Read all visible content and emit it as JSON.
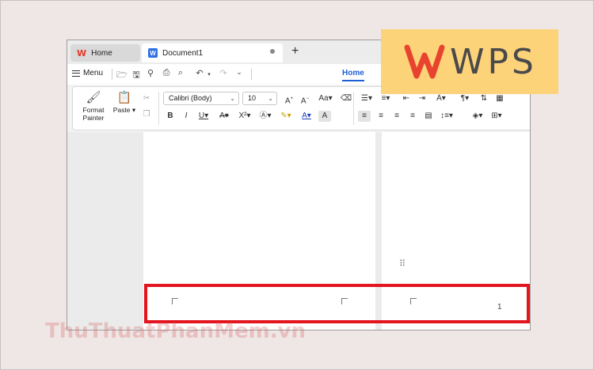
{
  "tabs": {
    "home_label": "Home",
    "document_label": "Document1",
    "new_tab_symbol": "+"
  },
  "menu": {
    "menu_label": "Menu",
    "active_ribbon_tab": "Home"
  },
  "ribbon": {
    "format_painter_label": "Format\nPainter",
    "paste_label": "Paste",
    "font_name": "Calibri (Body)",
    "font_size": "10"
  },
  "document": {
    "page_number": "1"
  },
  "brand": {
    "logo_text": "WPS",
    "accent_color": "#e3151e",
    "logo_bg": "#fdd37a"
  },
  "watermark": {
    "text": "ThuThuatPhanMem.vn"
  }
}
